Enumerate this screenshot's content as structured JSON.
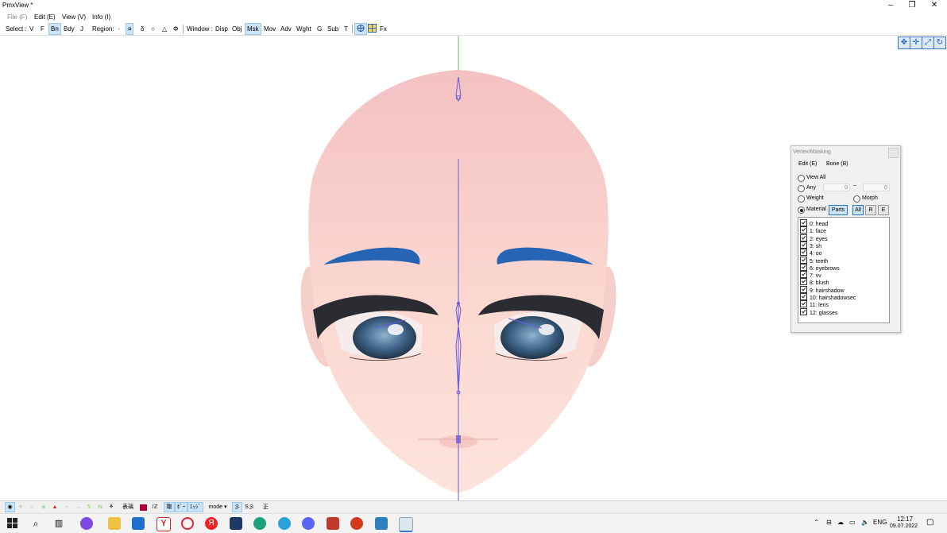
{
  "window": {
    "title": "PmxView *"
  },
  "menu": {
    "file": "File (F)",
    "edit": "Edit (E)",
    "view": "View (V)",
    "info": "Info (I)"
  },
  "toolbar": {
    "select_label": "Select :",
    "select_items": [
      "V",
      "F",
      "Bn",
      "Bdy",
      "J"
    ],
    "region_label": "Region:",
    "region_items": [
      "·",
      "¤",
      "δ",
      "○",
      "△",
      "Φ"
    ],
    "window_label": "Window :",
    "window_items": [
      "Disp",
      "Obj",
      "Msk",
      "Mov",
      "Adv",
      "Wght",
      "G",
      "Sub",
      "T"
    ],
    "fx": "Fx"
  },
  "panel": {
    "title": "Vertex/Masking",
    "menu_edit": "Edit (E)",
    "menu_bone": "Bone (B)",
    "view_all": "View All",
    "any": "Any",
    "any_from": "0",
    "tilde": "~",
    "any_to": "0",
    "weight": "Weight",
    "morph": "Morph",
    "material": "Material",
    "parts_btn": "Parts",
    "all_btn": "All",
    "r_btn": "R",
    "e_btn": "E",
    "materials": [
      "0: head",
      "1: face",
      "2: eyes",
      "3: sh",
      "4: oo",
      "5: teeth",
      "6: eyebrows",
      "7: vv",
      "8: blush",
      "9: hairshadow",
      "10: hairshadowsec",
      "11: lens",
      "12: glasses"
    ]
  },
  "bottom": {
    "b1": "表璃",
    "b2": "/ℤ",
    "b3": "鞄",
    "b4": "ﾎﾞｰ",
    "b5": "ｴｯｼﾞ",
    "mode": "mode",
    "b6": "彡",
    "b7": "S彡",
    "b8": "正"
  },
  "taskbar": {
    "lang": "ENG",
    "time": "12:17",
    "date": "09.07.2022"
  }
}
